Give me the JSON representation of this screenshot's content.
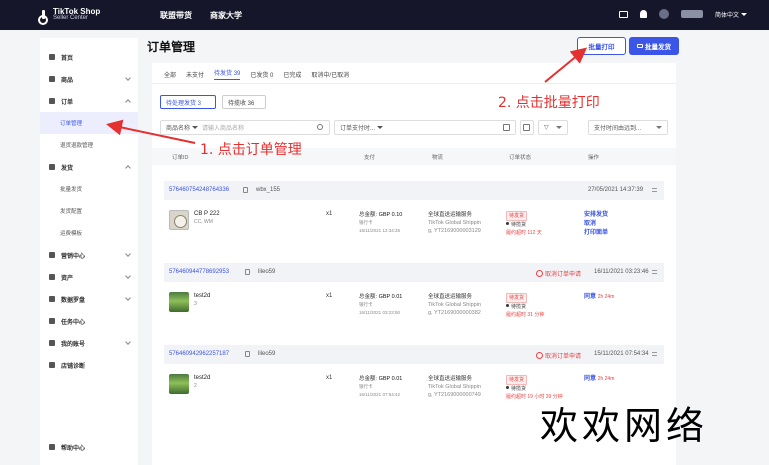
{
  "topbar": {
    "logo_line1": "TikTok Shop",
    "logo_line2": "Seller Center",
    "nav": [
      "联盟带货",
      "商家大学"
    ],
    "lang": "简体中文"
  },
  "sidebar": {
    "items": [
      {
        "label": "首页"
      },
      {
        "label": "商品"
      },
      {
        "label": "订单"
      },
      {
        "label": "订单管理"
      },
      {
        "label": "退货退款管理"
      },
      {
        "label": "发货"
      },
      {
        "label": "批量发货"
      },
      {
        "label": "发货配置"
      },
      {
        "label": "运费模板"
      },
      {
        "label": "营销中心"
      },
      {
        "label": "资产"
      },
      {
        "label": "数据罗盘"
      },
      {
        "label": "任务中心"
      },
      {
        "label": "我的账号"
      },
      {
        "label": "店铺诊断"
      },
      {
        "label": "帮助中心"
      }
    ]
  },
  "page": {
    "title": "订单管理",
    "batch_print": "批量打印",
    "batch_ship": "批量发货"
  },
  "tabs": [
    "全部",
    "未支付",
    "待发货 39",
    "已发货 0",
    "已完成",
    "取消中/已取消"
  ],
  "chips": [
    "待处理发货 3",
    "待揽收 36"
  ],
  "filters": {
    "product_name": "商品名称",
    "product_placeholder": "请输入商品名称",
    "order_time": "订单支付时...",
    "sort": "支付时间由远到..."
  },
  "table_headers": [
    "订单ID",
    "支付",
    "物流",
    "订单状态",
    "操作"
  ],
  "orders": [
    {
      "id": "576460754248764336",
      "buyer": "wbx_155",
      "cancel_req": "",
      "time": "27/05/2021 14:37:39",
      "product": "CB P 222",
      "variant": "CC, WM",
      "qty": "x1",
      "total": "总金额:",
      "amount": "GBP 0.10",
      "method": "银行卡",
      "pay_time": "16/11/2021 12:34:25",
      "carrier": "全球直送运输服务",
      "carrier_en": "TikTok Global Shippin",
      "tracking": "g, YT2169000003129",
      "status_tag": "待发货",
      "status_line": "待揽货",
      "late": "履约超时 112 天",
      "actions": [
        "安排发货",
        "取消",
        "打印面单"
      ],
      "countdown": ""
    },
    {
      "id": "576460944778692953",
      "buyer": "lileo59",
      "cancel_req": "取消订单申请",
      "time": "16/11/2021 03:23:46",
      "product": "test2d",
      "variant": "3",
      "qty": "x1",
      "total": "总金额:",
      "amount": "GBP 0.01",
      "method": "银行卡",
      "pay_time": "16/11/2021 03:23:50",
      "carrier": "全球直送运输服务",
      "carrier_en": "TikTok Global Shippin",
      "tracking": "g, YT2169000000382",
      "status_tag": "待发货",
      "status_line": "待揽货",
      "late": "履约超时 31 分钟",
      "actions": [
        "同意"
      ],
      "countdown": "2h 24m"
    },
    {
      "id": "576460942962257187",
      "buyer": "lileo59",
      "cancel_req": "取消订单申请",
      "time": "15/11/2021 07:54:34",
      "product": "test2d",
      "variant": "2",
      "qty": "x1",
      "total": "总金额:",
      "amount": "GBP 0.01",
      "method": "银行卡",
      "pay_time": "16/11/2021 07:54:42",
      "carrier": "全球直送运输服务",
      "carrier_en": "TikTok Global Shippin",
      "tracking": "g, YT2169000000749",
      "status_tag": "待发货",
      "status_line": "待揽货",
      "late": "履约超时 19 小时 39 分钟",
      "actions": [
        "同意"
      ],
      "countdown": "2h 24m"
    }
  ],
  "annotations": {
    "step1": "1. 点击订单管理",
    "step2": "2. 点击批量打印",
    "watermark": "欢欢网络"
  },
  "colors": {
    "topbar": "#15162a",
    "accent": "#3b55e6",
    "annotation": "#e53030",
    "danger": "#e54545"
  }
}
